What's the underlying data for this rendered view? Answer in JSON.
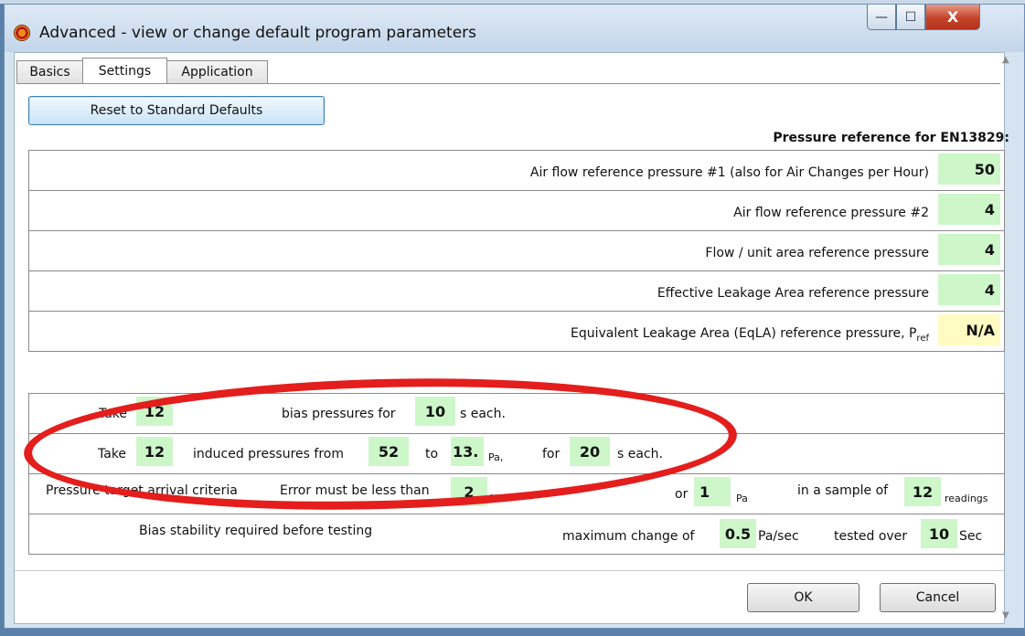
{
  "window": {
    "title": "Advanced - view or change default program parameters",
    "minimize_glyph": "—",
    "maximize_glyph": "☐",
    "close_glyph": "X"
  },
  "tabs": [
    {
      "label": "Basics",
      "selected": false
    },
    {
      "label": "Settings",
      "selected": true
    },
    {
      "label": "Application",
      "selected": false
    }
  ],
  "reset_button_label": "Reset to Standard Defaults",
  "reference": {
    "heading": "Pressure reference for EN13829:",
    "rows": [
      {
        "label": "Air flow reference pressure #1 (also for Air Changes per Hour)",
        "value": "50"
      },
      {
        "label": "Air flow reference pressure #2",
        "value": "4"
      },
      {
        "label": "Flow / unit area reference pressure",
        "value": "4"
      },
      {
        "label": "Effective Leakage Area reference pressure",
        "value": "4"
      },
      {
        "label": "Equivalent Leakage Area (EqLA) reference pressure, P",
        "subscript": "ref",
        "value": "N/A"
      }
    ]
  },
  "bias": {
    "take_label": "Take",
    "count": "12",
    "text": "bias pressures for",
    "seconds": "10",
    "each_label": "s each."
  },
  "induced": {
    "take_label": "Take",
    "count": "12",
    "text": "induced pressures from",
    "from": "52",
    "to_label": "to",
    "to": "13.",
    "unit": "Pa,",
    "for_label": "for",
    "seconds": "20",
    "each_label": "s each."
  },
  "target": {
    "label": "Pressure target arrival criteria",
    "error_label": "Error must be less than",
    "error_value": "2",
    "error_unit": "%",
    "or_label": "or",
    "pa_value": "1",
    "pa_unit": "Pa",
    "sample_label": "in a sample of",
    "readings": "12",
    "readings_label": "readings"
  },
  "stability": {
    "label": "Bias stability required before testing",
    "change_label": "maximum change of",
    "change_value": "0.5",
    "change_unit": "Pa/sec",
    "tested_label": "tested over",
    "tested_value": "10",
    "tested_unit": "Sec"
  },
  "buttons": {
    "ok": "OK",
    "cancel": "Cancel"
  },
  "colors": {
    "value_bg": "#cdf7c9",
    "na_bg": "#fffbc2",
    "annotation": "#e41d1d"
  }
}
